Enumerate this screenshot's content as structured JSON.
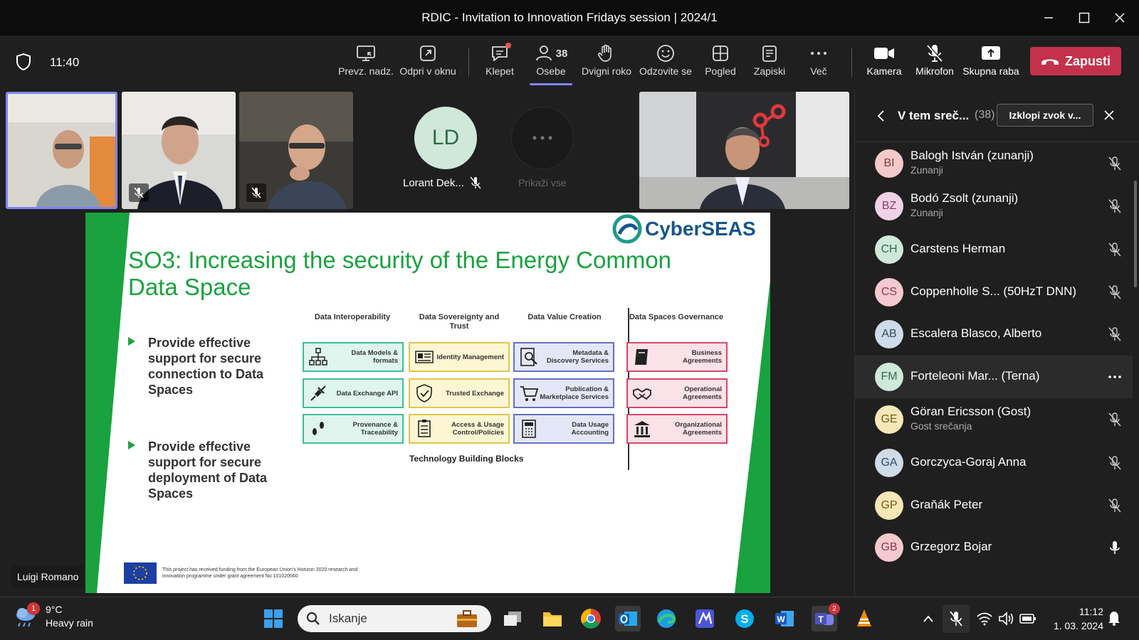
{
  "window": {
    "title": "RDIC - Invitation to Innovation Fridays session | 2024/1"
  },
  "toolbar": {
    "time": "11:40",
    "buttons": {
      "share_tray": "Prevz. nadz.",
      "popout": "Odpri v oknu",
      "chat": "Klepet",
      "people": "Osebe",
      "people_count": "38",
      "raise_hand": "Dvigni roko",
      "react": "Odzovite se",
      "view": "Pogled",
      "notes": "Zapiski",
      "more": "Več",
      "camera": "Kamera",
      "mic": "Mikrofon",
      "share": "Skupna raba",
      "leave": "Zapusti"
    }
  },
  "videos": {
    "lorant_initials": "LD",
    "lorant_name": "Lorant Dek...",
    "show_all": "Prikaži vse",
    "presenter_label": "Luigi Romano"
  },
  "slide": {
    "logo": "CyberSEAS",
    "title": "SO3: Increasing the security of the Energy Common Data Space",
    "bullets": [
      "Provide effective support for secure connection to Data Spaces",
      "Provide effective support for secure deployment of Data Spaces"
    ],
    "columns": [
      "Data Interoperability",
      "Data Sovereignty and Trust",
      "Data Value Creation",
      "Data Spaces Governance"
    ],
    "blocks": {
      "green": [
        "Data Models & formats",
        "Data Exchange API",
        "Provenance & Traceability"
      ],
      "yellow": [
        "Identity Management",
        "Trusted Exchange",
        "Access & Usage Control/Policies"
      ],
      "blue": [
        "Metadata & Discovery Services",
        "Publication & Marketplace Services",
        "Data Usage Accounting"
      ],
      "red": [
        "Business Agreements",
        "Operational Agreements",
        "Organizational Agreements"
      ]
    },
    "tbb_label": "Technology Building Blocks",
    "funding": "This project has received funding from the European Union's Horizon 2020 research and innovation programme under grant agreement No 101020560"
  },
  "panel": {
    "title": "V tem sreč...",
    "count": "(38)",
    "mute_all": "Izklopi zvok v...",
    "people": [
      {
        "initials": "BI",
        "name": "Balogh István (zunanji)",
        "sub": "Zunanji",
        "color": "#f4c9c9",
        "fg": "#8a3a3a",
        "mic": "muted"
      },
      {
        "initials": "BZ",
        "name": "Bodó Zsolt (zunanji)",
        "sub": "Zunanji",
        "color": "#f0d2e6",
        "fg": "#8a3a6a",
        "mic": "muted"
      },
      {
        "initials": "CH",
        "name": "Carstens Herman",
        "sub": "",
        "color": "#cfe8da",
        "fg": "#2e6b4a",
        "mic": "muted"
      },
      {
        "initials": "CS",
        "name": "Coppenholle S...  (50HzT DNN)",
        "sub": "",
        "color": "#f4c9cf",
        "fg": "#8a3a4a",
        "mic": "muted"
      },
      {
        "initials": "AB",
        "name": "Escalera Blasco, Alberto",
        "sub": "",
        "color": "#cfdbe8",
        "fg": "#2e4b6b",
        "mic": "muted"
      },
      {
        "initials": "FM",
        "name": "Forteleoni Mar...  (Terna)",
        "sub": "",
        "color": "#cfe8da",
        "fg": "#2e6b4a",
        "mic": "more"
      },
      {
        "initials": "GE",
        "name": "Göran Ericsson (Gost)",
        "sub": "Gost srečanja",
        "color": "#f6e7b8",
        "fg": "#7a5a10",
        "mic": "muted"
      },
      {
        "initials": "GA",
        "name": "Gorczyca-Goraj Anna",
        "sub": "",
        "color": "#cfdbe8",
        "fg": "#2e4b6b",
        "mic": "muted"
      },
      {
        "initials": "GP",
        "name": "Graňák Peter",
        "sub": "",
        "color": "#f6e7b8",
        "fg": "#7a5a10",
        "mic": "muted"
      },
      {
        "initials": "GB",
        "name": "Grzegorz Bojar",
        "sub": "",
        "color": "#f4c9cf",
        "fg": "#8a3a4a",
        "mic": "on"
      }
    ]
  },
  "taskbar": {
    "weather_temp": "9°C",
    "weather_desc": "Heavy rain",
    "weather_badge": "1",
    "search_placeholder": "Iskanje",
    "teams_badge": "2",
    "clock_time": "11:12",
    "clock_date": "1. 03. 2024"
  }
}
